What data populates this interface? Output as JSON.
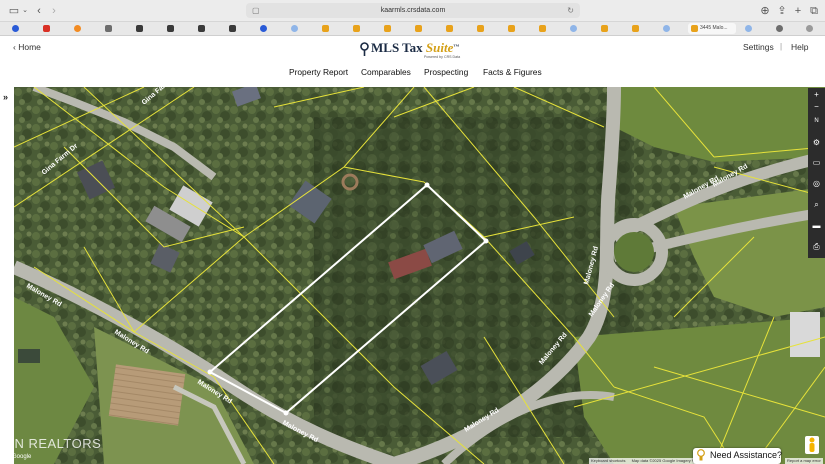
{
  "browser": {
    "url": "kaarmls.crsdata.com",
    "tab_title": "3445 Malo..."
  },
  "header": {
    "home_label": "Home",
    "logo_main": "MLS Tax ",
    "logo_accent": "Suite",
    "logo_tm": "TM",
    "logo_sub": "Powered by CRS Data",
    "settings_label": "Settings",
    "help_label": "Help"
  },
  "nav": [
    {
      "label": "Property Report"
    },
    {
      "label": "Comparables"
    },
    {
      "label": "Prospecting"
    },
    {
      "label": "Facts & Figures"
    }
  ],
  "map": {
    "watermark": "TN REALTORS",
    "google_logo": "Google",
    "attribution": [
      "Keyboard shortcuts",
      "Map data ©2025 Google Imagery ©2025"
    ],
    "attribution_right": "Report a map error",
    "road_labels": [
      {
        "label": "Maloney Rd"
      },
      {
        "label": "Maloney Rd"
      },
      {
        "label": "Maloney Rd"
      },
      {
        "label": "Maloney Rd"
      },
      {
        "label": "Maloney Rd"
      },
      {
        "label": "Maloney Rd"
      },
      {
        "label": "Maloney Rd"
      },
      {
        "label": "Maloney Rd"
      },
      {
        "label": "Maloney Rd"
      },
      {
        "label": "Maloney Rd"
      },
      {
        "label": "Gina Farm Dr"
      },
      {
        "label": "Gina Farm"
      }
    ],
    "controls": [
      "zoom-in",
      "zoom-out",
      "compass",
      "settings",
      "rectangle",
      "location",
      "search",
      "layers",
      "print"
    ]
  },
  "assist": {
    "label": "Need Assistance?"
  },
  "colors": {
    "parcel_lines": "#e6e23a",
    "subject_parcel": "#ffffff",
    "roads": "#b9b9b0",
    "logo_navy": "#1b2b44",
    "logo_gold": "#d4a017"
  }
}
